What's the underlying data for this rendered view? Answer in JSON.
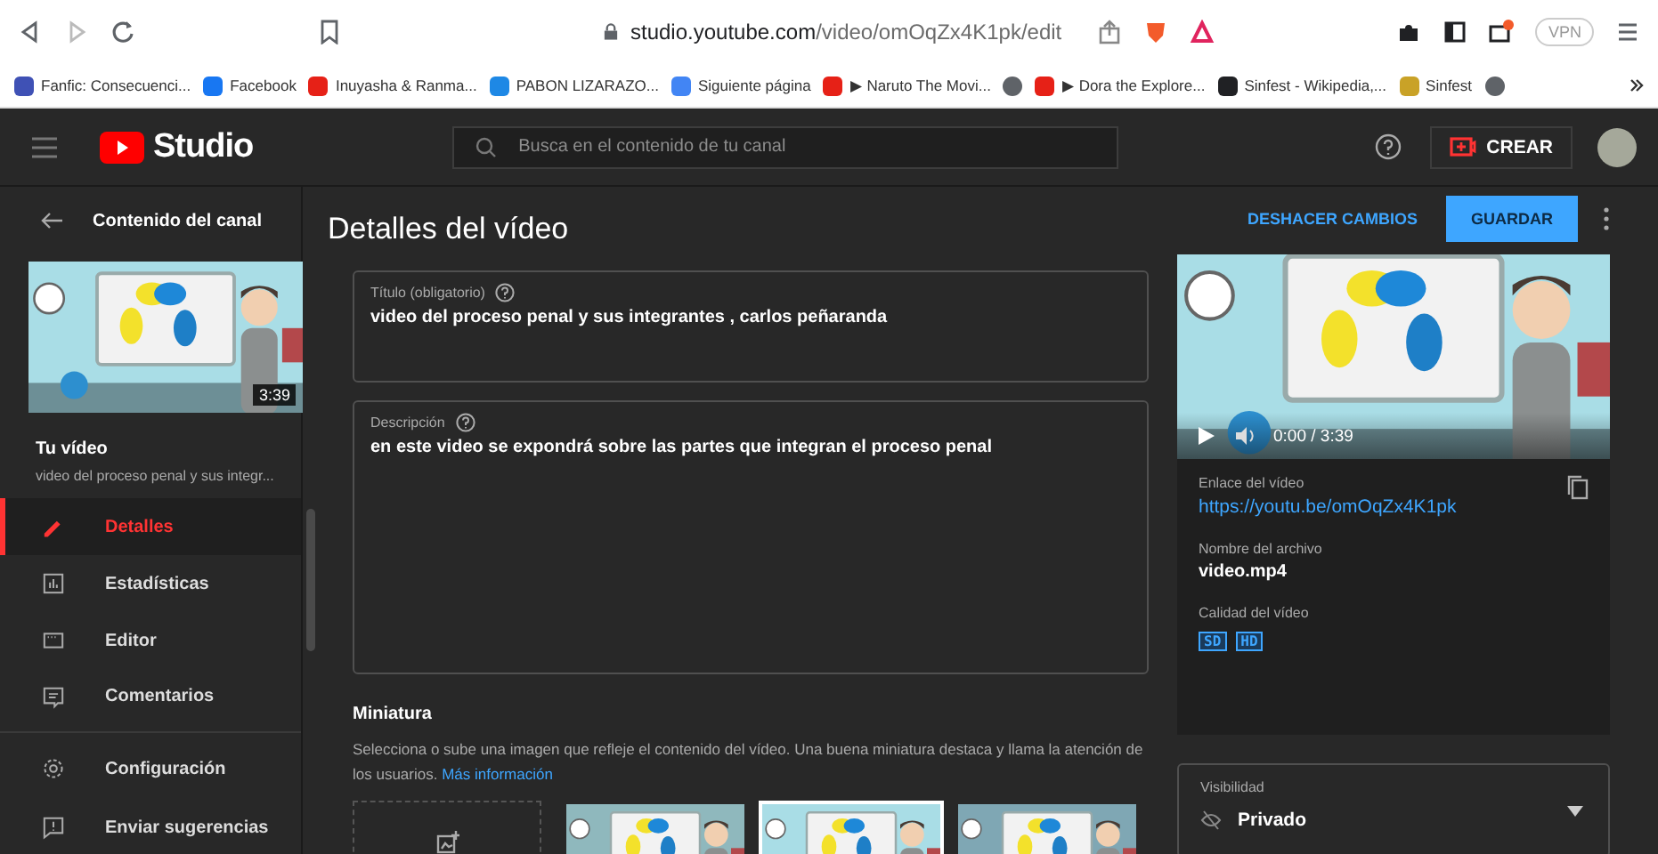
{
  "browser": {
    "url_host": "studio.youtube.com",
    "url_path": "/video/omOqZx4K1pk/edit",
    "vpn": "VPN",
    "bookmarks": [
      {
        "label": "Fanfic: Consecuenci...",
        "color": "#3f51b5"
      },
      {
        "label": "Facebook",
        "color": "#1877f2"
      },
      {
        "label": "Inuyasha & Ranma...",
        "color": "#e62117"
      },
      {
        "label": "PABON LIZARAZO...",
        "color": "#1e88e5"
      },
      {
        "label": "Siguiente página",
        "color": "#4285f4"
      },
      {
        "label": "▶ Naruto The Movi...",
        "color": "#e62117"
      },
      {
        "color": "#5f6368"
      },
      {
        "label": "▶ Dora the Explore...",
        "color": "#e62117"
      },
      {
        "label": "Sinfest - Wikipedia,...",
        "color": "#202124"
      },
      {
        "label": "Sinfest",
        "color": "#c9a227"
      },
      {
        "color": "#5f6368"
      }
    ]
  },
  "header": {
    "logo": "Studio",
    "search_placeholder": "Busca en el contenido de tu canal",
    "create": "CREAR"
  },
  "sidebar": {
    "back_label": "Contenido del canal",
    "duration": "3:39",
    "your_video": "Tu vídeo",
    "video_title": "video del proceso penal y sus integr...",
    "items": [
      {
        "label": "Detalles",
        "selected": true
      },
      {
        "label": "Estadísticas",
        "selected": false
      },
      {
        "label": "Editor",
        "selected": false
      },
      {
        "label": "Comentarios",
        "selected": false
      }
    ],
    "footer_items": [
      {
        "label": "Configuración",
        "selected": false
      },
      {
        "label": "Enviar sugerencias",
        "selected": false
      }
    ]
  },
  "main": {
    "title": "Detalles del vídeo",
    "undo": "DESHACER CAMBIOS",
    "save": "GUARDAR",
    "title_field": {
      "label": "Título (obligatorio)",
      "value": "video del proceso penal y sus integrantes , carlos peñaranda"
    },
    "description_field": {
      "label": "Descripción",
      "value": "en este video se expondrá sobre las partes que integran el proceso penal"
    },
    "thumbnail": {
      "heading": "Miniatura",
      "text": "Selecciona o sube una imagen que refleje el contenido del vídeo. Una buena miniatura destaca y llama la atención de los usuarios.",
      "link": "Más información",
      "options": [
        {
          "kind": "upload",
          "selected": false
        },
        {
          "kind": "picture",
          "selected": false
        },
        {
          "kind": "picture",
          "selected": true
        },
        {
          "kind": "picture",
          "selected": false
        }
      ]
    }
  },
  "player": {
    "time": "0:00 / 3:39"
  },
  "info": {
    "link_label": "Enlace del vídeo",
    "link": "https://youtu.be/omOqZx4K1pk",
    "file_label": "Nombre del archivo",
    "file": "video.mp4",
    "quality_label": "Calidad del vídeo",
    "qualities": [
      "SD",
      "HD"
    ]
  },
  "visibility": {
    "label": "Visibilidad",
    "value": "Privado"
  }
}
